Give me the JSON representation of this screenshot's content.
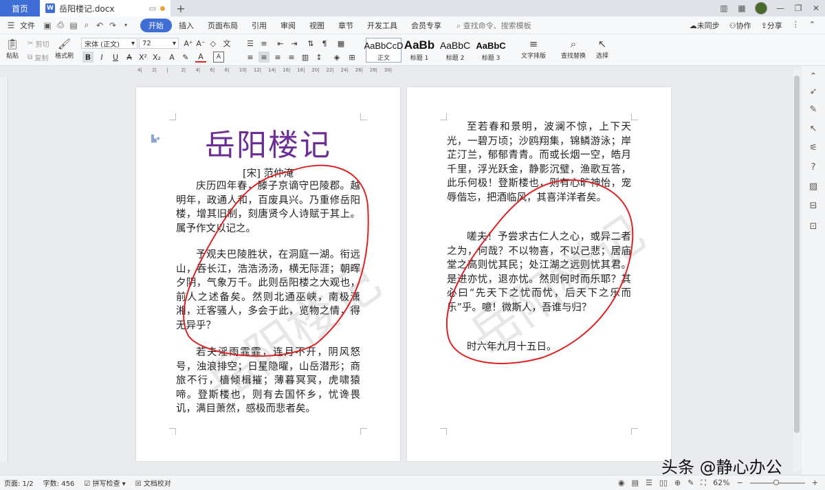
{
  "tabs": {
    "home": "首页",
    "doc_name": "岳阳楼记.docx",
    "new": "+"
  },
  "menubar": {
    "file": "文件",
    "items": [
      "开始",
      "插入",
      "页面布局",
      "引用",
      "审阅",
      "视图",
      "章节",
      "开发工具",
      "会员专享"
    ],
    "search": "查找命令、搜索模板",
    "sync": "未同步",
    "collab": "协作",
    "share": "分享"
  },
  "ribbon": {
    "paste": "粘贴",
    "cut": "剪切",
    "copy": "复制",
    "format_painter": "格式刷",
    "font_name": "宋体 (正文)",
    "font_size": "72",
    "styles": [
      {
        "preview": "AaBbCcD",
        "label": "正文"
      },
      {
        "preview": "AaBb",
        "label": "标题 1"
      },
      {
        "preview": "AaBbC",
        "label": "标题 2"
      },
      {
        "preview": "AaBbC",
        "label": "标题 3"
      }
    ],
    "text_layout": "文字排版",
    "find_replace": "查找替换",
    "select": "选择"
  },
  "ruler": {
    "ticks": [
      "4",
      "2",
      "",
      "2",
      "4",
      "6",
      "8",
      "10",
      "12",
      "14",
      "16",
      "18",
      "20",
      "22",
      "24",
      "26",
      "28",
      "30"
    ]
  },
  "document": {
    "title": "岳阳楼记",
    "author": "[宋] 范仲淹",
    "page1_paragraphs": [
      "庆历四年春，滕子京谪守巴陵郡。越明年，政通人和，百废具兴。乃重修岳阳楼，增其旧制，刻唐贤今人诗赋于其上。属予作文以记之。",
      "予观夫巴陵胜状，在洞庭一湖。衔远山，吞长江，浩浩汤汤，横无际涯；朝晖夕阴，气象万千。此则岳阳楼之大观也，前人之述备矣。然则北通巫峡，南极潇湘，迁客骚人，多会于此，览物之情，得无异乎？",
      "若夫淫雨霏霏，连月不开，阴风怒号，浊浪排空；日星隐曜，山岳潜形；商旅不行，樯倾楫摧；薄暮冥冥，虎啸猿啼。登斯楼也，则有去国怀乡，忧谗畏讥，满目萧然，感极而悲者矣。"
    ],
    "page2_paragraphs": [
      "至若春和景明，波澜不惊，上下天光，一碧万顷；沙鸥翔集，锦鳞游泳；岸芷汀兰，郁郁青青。而或长烟一空，皓月千里，浮光跃金，静影沉璧，渔歌互答，此乐何极！登斯楼也，则有心旷神怡，宠辱偕忘，把酒临风，其喜洋洋者矣。",
      "嗟夫！予尝求古仁人之心，或异二者之为，何哉？不以物喜，不以己悲；居庙堂之高则忧其民；处江湖之远则忧其君。是进亦忧，退亦忧。然则何时而乐耶？其必曰“先天下之忧而忧，后天下之乐而乐”乎。噫！微斯人，吾谁与归？",
      "时六年九月十五日。"
    ],
    "watermark": "岳阳楼记"
  },
  "status": {
    "page": "页面: 1/2",
    "words": "字数: 456",
    "spellcheck": "拼写检查",
    "proof": "文档校对",
    "zoom": "62%"
  },
  "brand": "头条 @静心办公"
}
